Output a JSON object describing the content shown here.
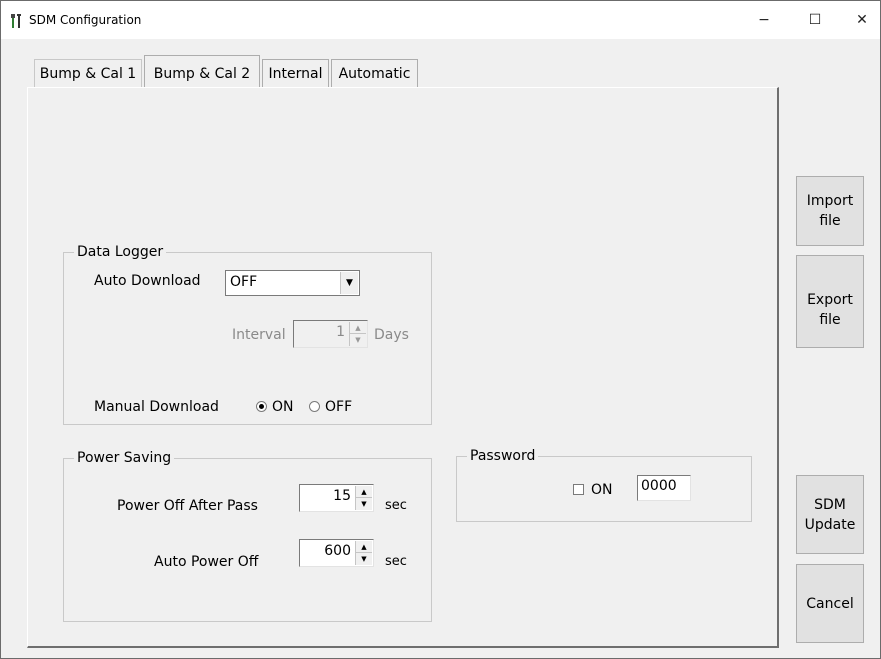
{
  "window": {
    "title": "SDM Configuration",
    "minimize_glyph": "−",
    "maximize_glyph": "☐",
    "close_glyph": "✕",
    "app_icon": "tools-icon"
  },
  "tabs": [
    {
      "label": "Bump & Cal 1",
      "active": false
    },
    {
      "label": "Bump & Cal 2",
      "active": true
    },
    {
      "label": "Internal",
      "active": false
    },
    {
      "label": "Automatic",
      "active": false
    }
  ],
  "data_logger": {
    "legend": "Data Logger",
    "auto_download_label": "Auto Download",
    "auto_download_value": "OFF",
    "interval_label": "Interval",
    "interval_value": "1",
    "interval_unit": "Days",
    "manual_download_label": "Manual Download",
    "manual_on_label": "ON",
    "manual_off_label": "OFF",
    "manual_selected": "ON"
  },
  "power_saving": {
    "legend": "Power Saving",
    "power_off_after_pass_label": "Power Off After Pass",
    "power_off_after_pass_value": "15",
    "power_off_after_pass_unit": "sec",
    "auto_power_off_label": "Auto Power Off",
    "auto_power_off_value": "600",
    "auto_power_off_unit": "sec"
  },
  "password": {
    "legend": "Password",
    "on_label": "ON",
    "on_checked": false,
    "value": "0000"
  },
  "buttons": {
    "import_line1": "Import",
    "import_line2": "file",
    "export_line1": "Export",
    "export_line2": "file",
    "sdm_update_line1": "SDM",
    "sdm_update_line2": "Update",
    "cancel": "Cancel"
  }
}
